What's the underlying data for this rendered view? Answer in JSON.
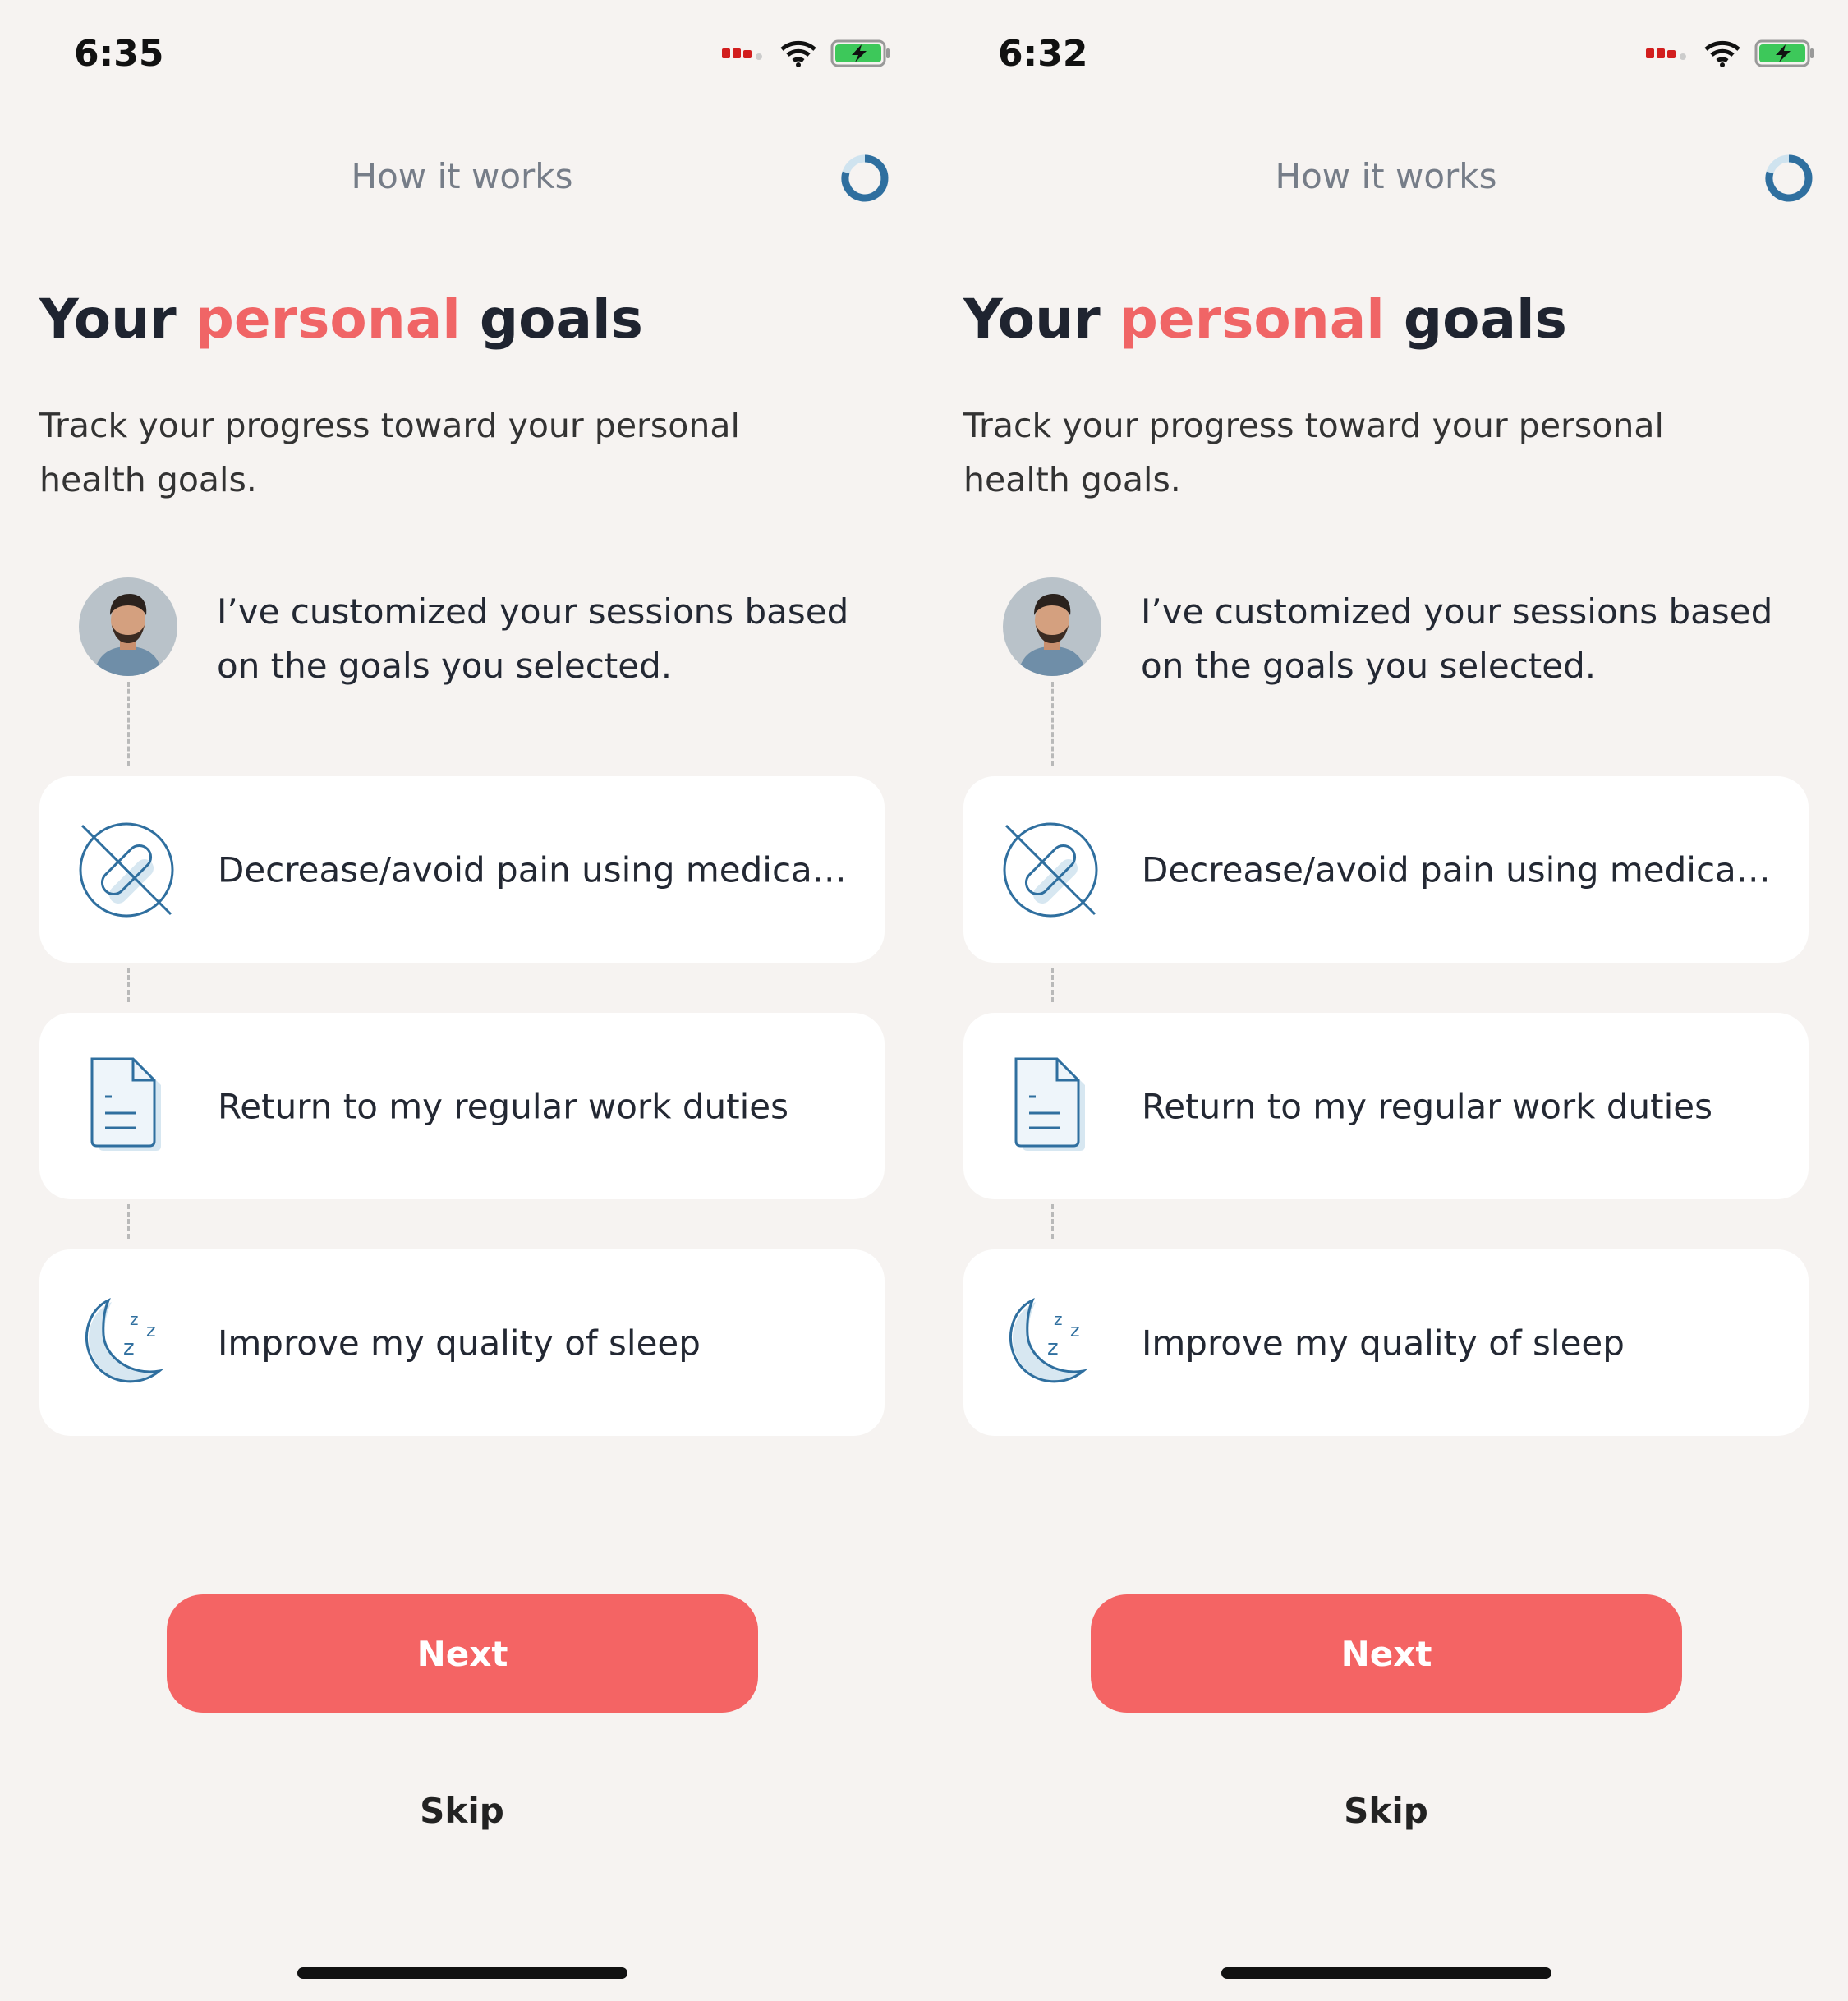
{
  "screens": [
    {
      "status": {
        "time": "6:35"
      },
      "header": {
        "title": "How it works"
      },
      "heading": {
        "prefix": "Your ",
        "accent": "personal",
        "suffix": " goals"
      },
      "subtitle": "Track your progress toward your personal health goals.",
      "coach": {
        "message": "I’ve customized your sessions based on the goals you selected."
      },
      "goals": [
        {
          "label": "Decrease/avoid pain using medicat...",
          "icon": "no-medication-icon"
        },
        {
          "label": "Return to my regular work duties",
          "icon": "document-icon"
        },
        {
          "label": "Improve my quality of sleep",
          "icon": "sleep-moon-icon"
        }
      ],
      "actions": {
        "next": "Next",
        "skip": "Skip"
      }
    },
    {
      "status": {
        "time": "6:32"
      },
      "header": {
        "title": "How it works"
      },
      "heading": {
        "prefix": "Your ",
        "accent": "personal",
        "suffix": " goals"
      },
      "subtitle": "Track your progress toward your personal health goals.",
      "coach": {
        "message": "I’ve customized your sessions based on the goals you selected."
      },
      "goals": [
        {
          "label": "Decrease/avoid pain using medicat...",
          "icon": "no-medication-icon"
        },
        {
          "label": "Return to my regular work duties",
          "icon": "document-icon"
        },
        {
          "label": "Improve my quality of sleep",
          "icon": "sleep-moon-icon"
        }
      ],
      "actions": {
        "next": "Next",
        "skip": "Skip"
      }
    }
  ],
  "colors": {
    "accent": "#f06566",
    "button": "#f46464",
    "icon": "#2f6f9f",
    "background": "#f6f3f1"
  }
}
